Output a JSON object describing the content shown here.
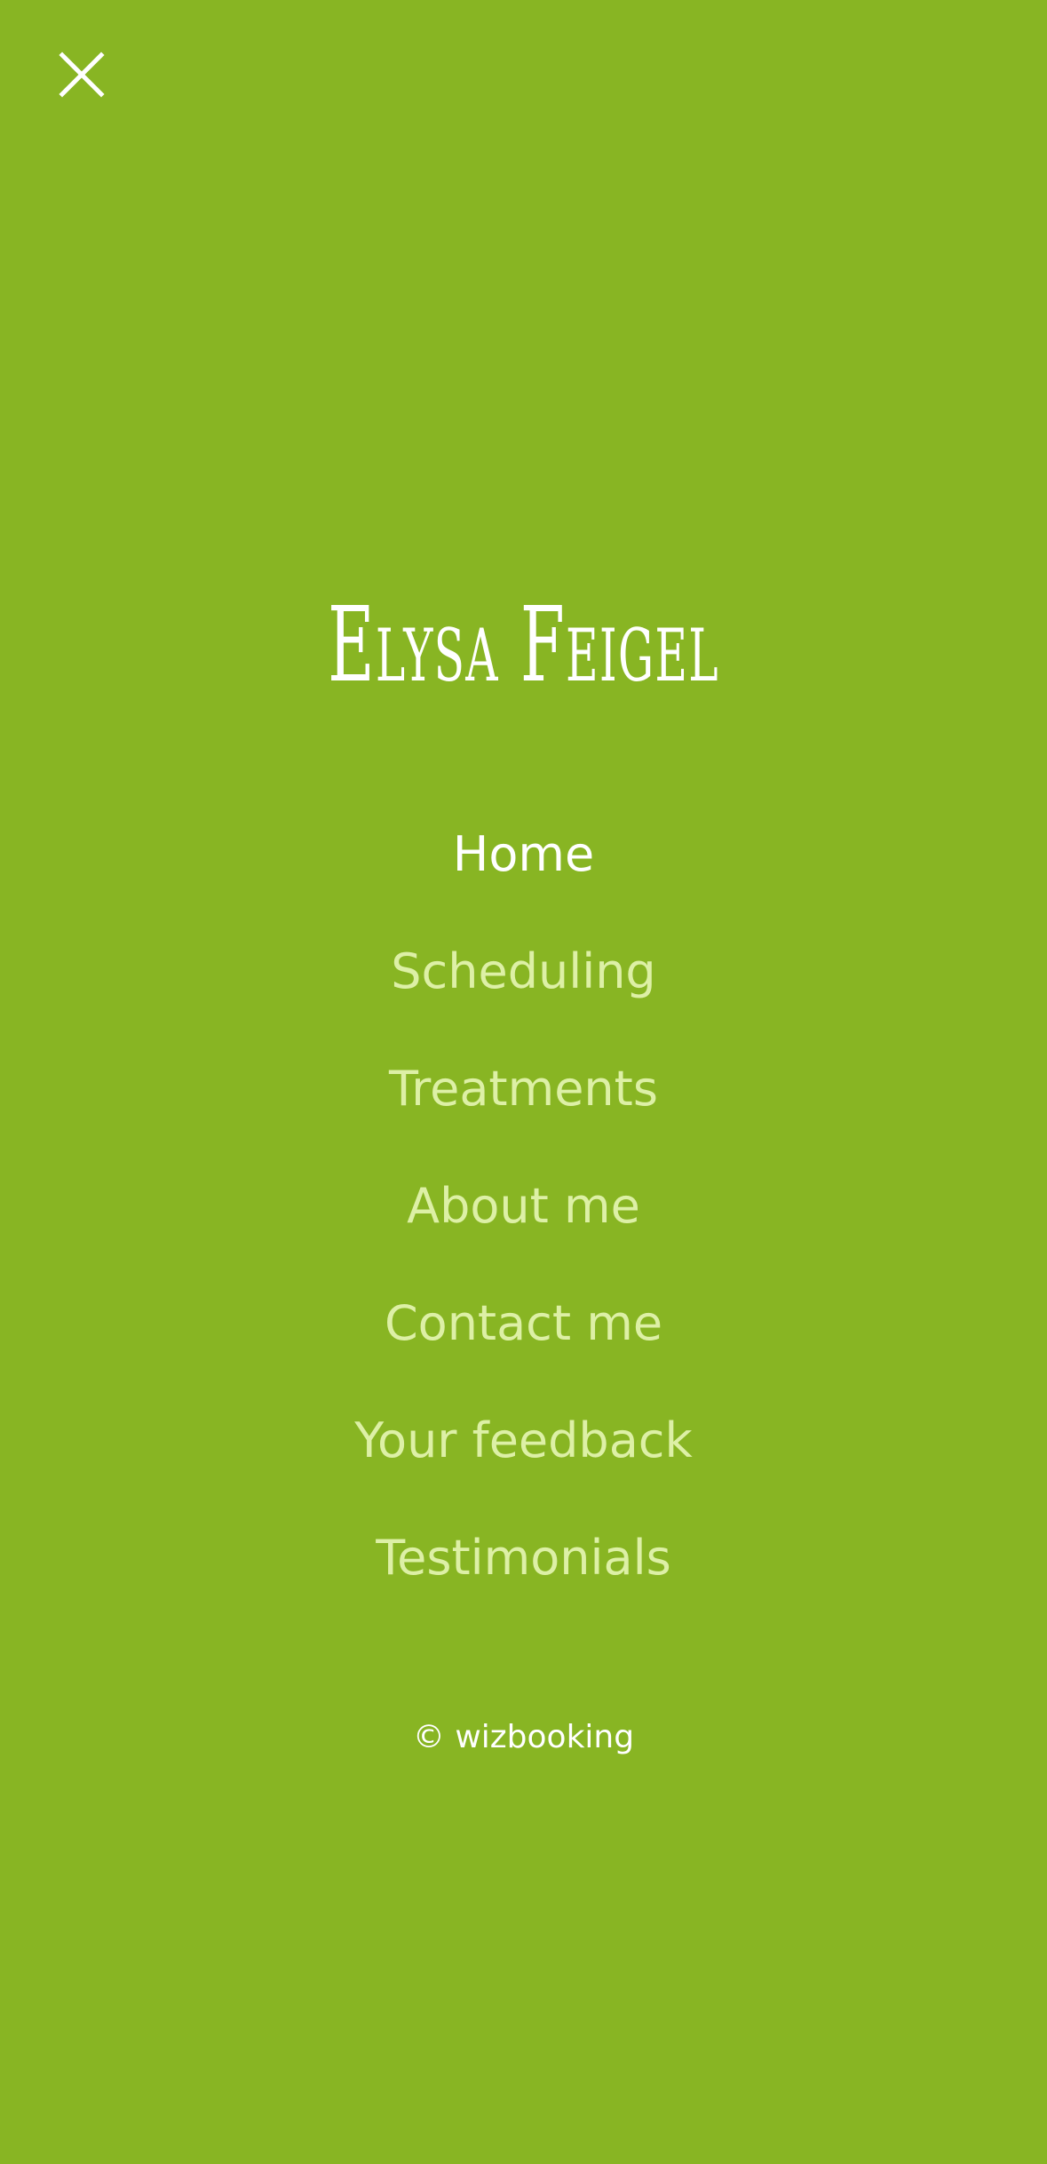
{
  "theme": {
    "background": "#88b523",
    "text_primary": "#ffffff",
    "text_secondary": "#ddf0a6"
  },
  "header": {
    "close_icon": "close-icon"
  },
  "brand": {
    "name": "Elysa Feigel"
  },
  "nav": {
    "items": [
      {
        "label": "Home",
        "active": true
      },
      {
        "label": "Scheduling",
        "active": false
      },
      {
        "label": "Treatments",
        "active": false
      },
      {
        "label": "About me",
        "active": false
      },
      {
        "label": "Contact me",
        "active": false
      },
      {
        "label": "Your feedback",
        "active": false
      },
      {
        "label": "Testimonials",
        "active": false
      }
    ]
  },
  "footer": {
    "copyright": "© wizbooking"
  }
}
